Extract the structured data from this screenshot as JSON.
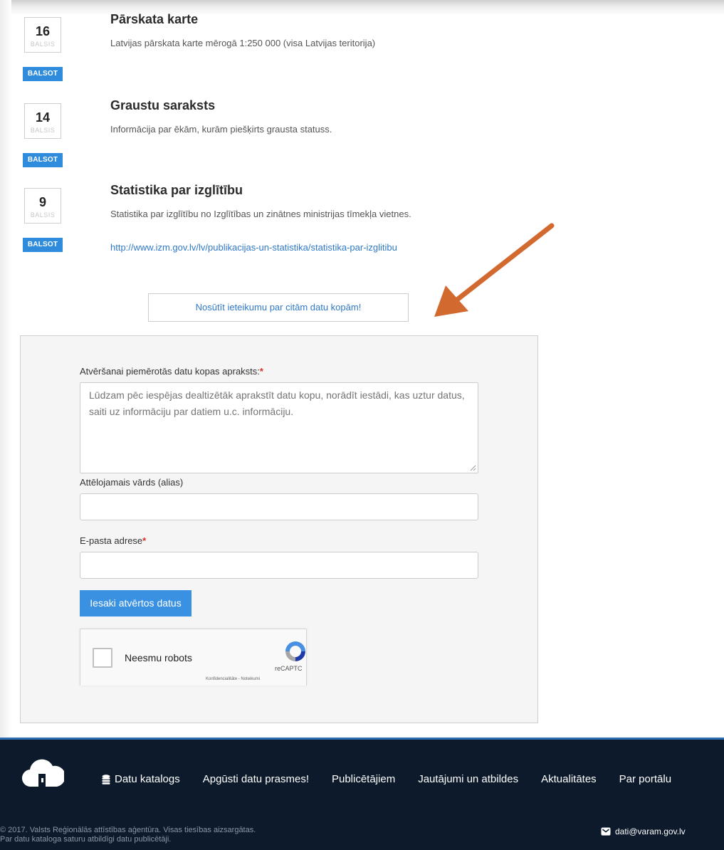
{
  "vote_unit": "BALSIS",
  "vote_button_label": "BALSOT",
  "items": [
    {
      "count": "16",
      "title": "Pārskata karte",
      "description": "Latvijas pārskata karte mērogā 1:250 000 (visa Latvijas teritorija)",
      "link": ""
    },
    {
      "count": "14",
      "title": "Graustu saraksts",
      "description": "Informācija par ēkām, kurām piešķirts grausta statuss.",
      "link": ""
    },
    {
      "count": "9",
      "title": "Statistika par izglītību",
      "description": "Statistika par izglītību no Izglītības un zinātnes ministrijas tīmekļa vietnes.",
      "link": "http://www.izm.gov.lv/lv/publikacijas-un-statistika/statistika-par-izglitibu"
    }
  ],
  "suggest_button_label": "Nosūtīt ieteikumu par citām datu kopām!",
  "form": {
    "description_label": "Atvēršanai piemērotās datu kopas apraksts:",
    "description_placeholder": "Lūdzam pēc iespējas dealtizētāk aprakstīt datu kopu, norādīt iestādi, kas uztur datus, saiti uz informāciju par datiem u.c. informāciju.",
    "alias_label": "Attēlojamais vārds (alias)",
    "alias_value": "",
    "email_label": "E-pasta adrese",
    "email_value": "",
    "required_mark": "*",
    "submit_label": "Iesaki atvērtos datus"
  },
  "recaptcha": {
    "checkbox_label": "Neesmu robots",
    "brand": "reCAPTC",
    "links": "Konfidencialitāte - Noteikumi"
  },
  "footer": {
    "nav": [
      "Datu katalogs",
      "Apgūsti datu prasmes!",
      "Publicētājiem",
      "Jautājumi un atbildes",
      "Aktualitātes",
      "Par portālu"
    ],
    "copyright_line1": "© 2017. Valsts Reģionālās attīstības aģentūra. Visas tiesības aizsargātas.",
    "copyright_line2": "Par datu kataloga saturu atbildīgi datu publicētāji.",
    "email": "dati@varam.gov.lv"
  },
  "colors": {
    "accent_blue": "#2f8bdc",
    "link_blue": "#2f79c8",
    "arrow_orange": "#d2692f",
    "footer_bg": "#0c1a2b",
    "required_red": "#d9302c"
  }
}
